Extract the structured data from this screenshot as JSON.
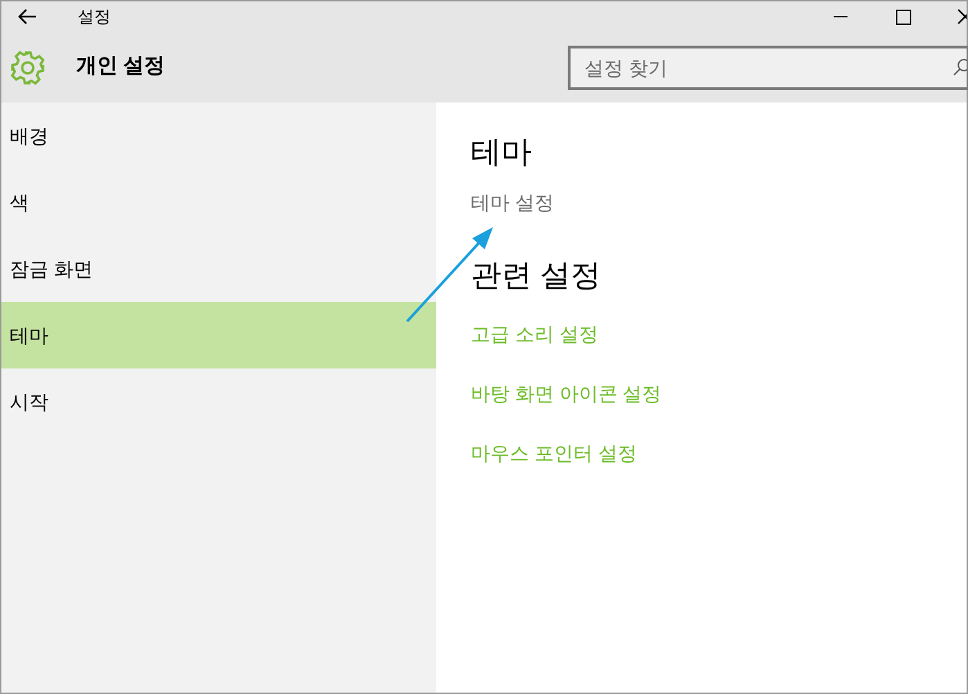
{
  "window": {
    "title": "설정"
  },
  "header": {
    "title": "개인 설정",
    "search": {
      "placeholder": "설정 찾기"
    }
  },
  "sidebar": {
    "items": [
      {
        "label": "배경",
        "selected": false
      },
      {
        "label": "색",
        "selected": false
      },
      {
        "label": "잠금 화면",
        "selected": false
      },
      {
        "label": "테마",
        "selected": true
      },
      {
        "label": "시작",
        "selected": false
      }
    ]
  },
  "content": {
    "title": "테마",
    "link": "테마 설정",
    "related_title": "관련 설정",
    "related_links": [
      "고급 소리 설정",
      "바탕 화면 아이콘 설정",
      "마우스 포인터 설정"
    ]
  }
}
